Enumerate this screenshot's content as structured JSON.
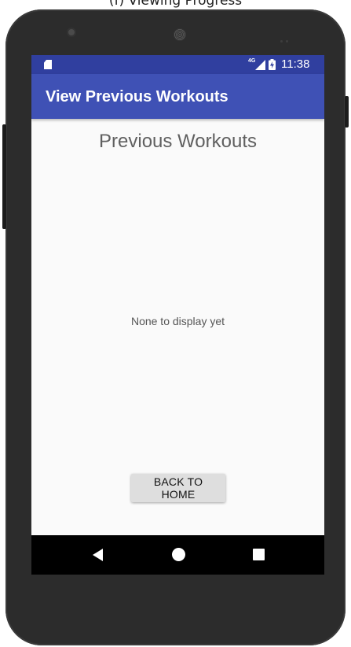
{
  "caption": {
    "text": "(f) Viewing Progress"
  },
  "status_bar": {
    "network": "4G",
    "time": "11:38",
    "icons": [
      "sd-card-icon",
      "signal-icon",
      "battery-charging-icon"
    ]
  },
  "app_bar": {
    "title": "View Previous Workouts",
    "color": "#3f51b5",
    "status_color": "#303f9f"
  },
  "main": {
    "heading": "Previous Workouts",
    "empty_message": "None to display yet",
    "back_button_label": "BACK TO HOME"
  },
  "nav_bar": {
    "buttons": [
      "back-icon",
      "home-icon",
      "recents-icon"
    ]
  }
}
